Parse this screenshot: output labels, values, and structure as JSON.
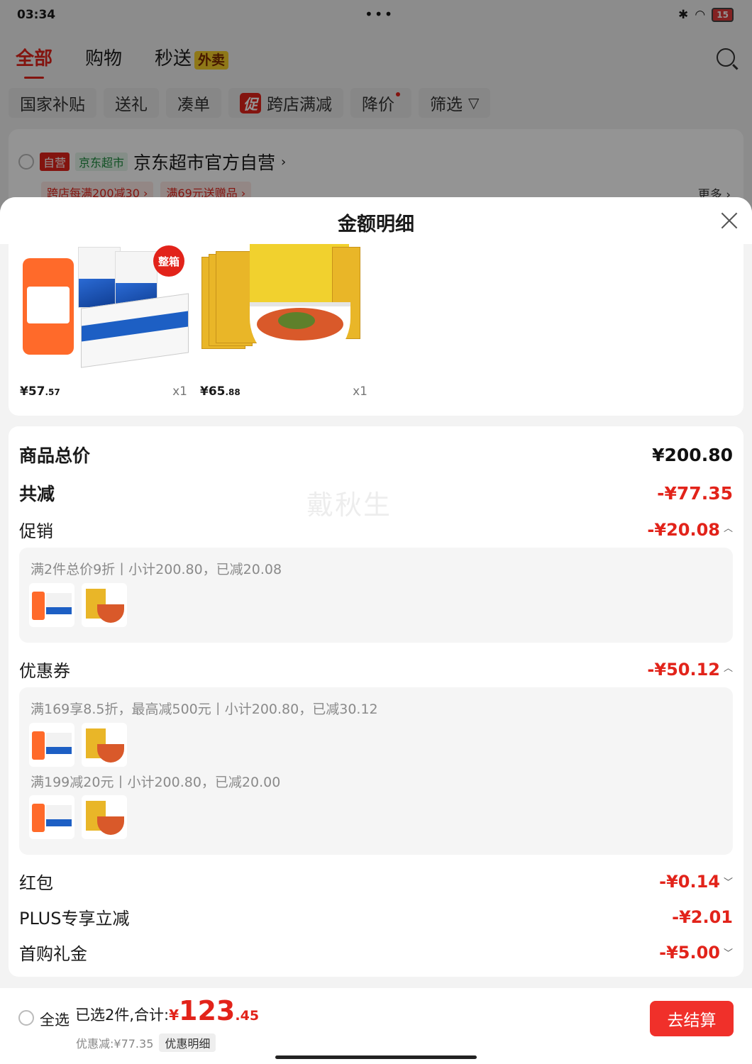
{
  "status_bar": {
    "time": "03:34",
    "dots": "•••",
    "battery": "15"
  },
  "top_tabs": [
    {
      "label": "全部",
      "active": true
    },
    {
      "label": "购物",
      "active": false
    },
    {
      "label": "秒送",
      "active": false,
      "badge": "外卖"
    }
  ],
  "filter_chips": [
    "国家补贴",
    "送礼",
    "凑单",
    "跨店满减",
    "降价",
    "筛选"
  ],
  "filter_promo_tag": "促",
  "store": {
    "ziying_tag": "自营",
    "jdsc_tag": "京东超市",
    "name": "京东超市官方自营",
    "promos": [
      "跨店每满200减30 ›",
      "满69元送赠品 ›"
    ],
    "more": "更多 ›"
  },
  "sheet": {
    "title": "金额明细"
  },
  "products": [
    {
      "price_int": "¥57",
      "price_dec": ".57",
      "qty": "x1",
      "badge": "整箱"
    },
    {
      "price_int": "¥65",
      "price_dec": ".88",
      "qty": "x1"
    }
  ],
  "detail": {
    "watermark": "戴秋生",
    "total_label": "商品总价",
    "total_value": "¥200.80",
    "discount_label": "共减",
    "discount_value": "-¥77.35",
    "promo_label": "促销",
    "promo_value": "-¥20.08",
    "promo_line": "满2件总价9折丨小计200.80，已减20.08",
    "coupon_label": "优惠券",
    "coupon_value": "-¥50.12",
    "coupon_line1": "满169享8.5折，最高减500元丨小计200.80，已减30.12",
    "coupon_line2": "满199减20元丨小计200.80，已减20.00",
    "redpacket_label": "红包",
    "redpacket_value": "-¥0.14",
    "plus_label": "PLUS专享立减",
    "plus_value": "-¥2.01",
    "firstbuy_label": "首购礼金",
    "firstbuy_value": "-¥5.00"
  },
  "bottom_bar": {
    "select_all": "全选",
    "selected_text": "已选2件,合计:",
    "currency": "¥",
    "total_int": "123",
    "total_dec": ".45",
    "discount_text": "优惠减:¥77.35",
    "detail_button": "优惠明细",
    "checkout": "去结算"
  },
  "colors": {
    "accent": "#e2231a",
    "checkout": "#f0302a"
  }
}
